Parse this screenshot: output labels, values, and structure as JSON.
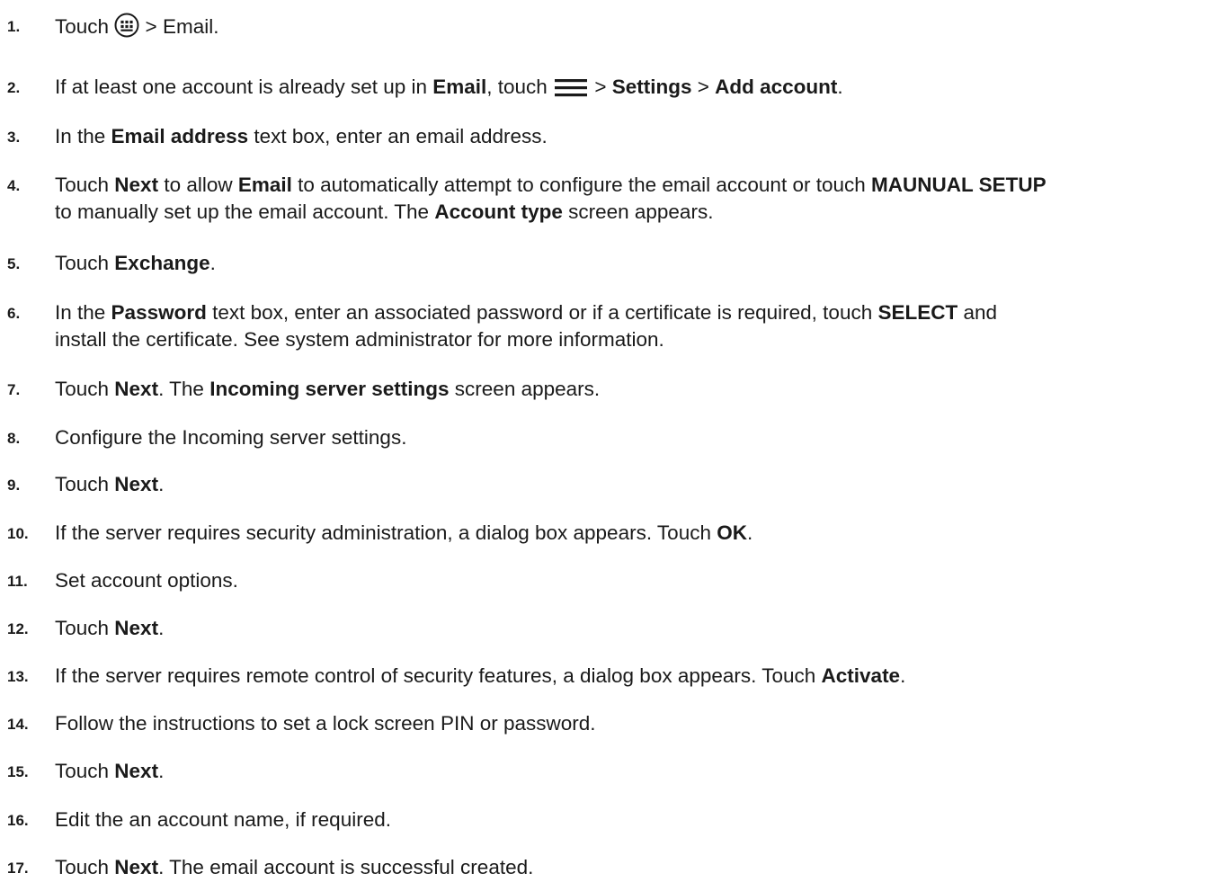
{
  "steps": [
    {
      "num": "1.",
      "parts": [
        {
          "t": "Touch "
        },
        {
          "icon": "apps-grid-icon"
        },
        {
          "t": " > Email."
        }
      ]
    },
    {
      "num": "2.",
      "parts": [
        {
          "t": "If at least one account is already set up in "
        },
        {
          "b": "Email"
        },
        {
          "t": ", touch "
        },
        {
          "icon": "menu-icon"
        },
        {
          "t": " > "
        },
        {
          "b": "Settings"
        },
        {
          "t": " > "
        },
        {
          "b": "Add account"
        },
        {
          "t": "."
        }
      ]
    },
    {
      "num": "3.",
      "parts": [
        {
          "t": "In the "
        },
        {
          "b": "Email address"
        },
        {
          "t": " text box, enter an email address."
        }
      ]
    },
    {
      "num": "4.",
      "parts": [
        {
          "t": "Touch "
        },
        {
          "b": "Next"
        },
        {
          "t": " to allow "
        },
        {
          "b": "Email"
        },
        {
          "t": " to automatically attempt to configure the email account or touch "
        },
        {
          "b": "MAUNUAL SETUP"
        },
        {
          "br": true
        },
        {
          "t": "to manually set up the email account. The "
        },
        {
          "b": "Account type"
        },
        {
          "t": " screen appears."
        }
      ]
    },
    {
      "num": "5.",
      "parts": [
        {
          "t": "Touch "
        },
        {
          "b": "Exchange"
        },
        {
          "t": "."
        }
      ]
    },
    {
      "num": "6.",
      "parts": [
        {
          "t": "In the "
        },
        {
          "b": "Password"
        },
        {
          "t": " text box, enter an associated password or if a certificate is required, touch "
        },
        {
          "b": "SELECT"
        },
        {
          "t": " and"
        },
        {
          "br": true
        },
        {
          "t": "install the certificate. See system administrator for more information."
        }
      ]
    },
    {
      "num": "7.",
      "parts": [
        {
          "t": "Touch "
        },
        {
          "b": "Next"
        },
        {
          "t": ". The "
        },
        {
          "b": "Incoming server settings"
        },
        {
          "t": " screen appears."
        }
      ]
    },
    {
      "num": "8.",
      "parts": [
        {
          "t": "Configure the Incoming server settings."
        }
      ]
    },
    {
      "num": "9.",
      "parts": [
        {
          "t": "Touch "
        },
        {
          "b": "Next"
        },
        {
          "t": "."
        }
      ]
    },
    {
      "num": "10.",
      "parts": [
        {
          "t": "If the server requires security administration, a dialog box appears. Touch "
        },
        {
          "b": "OK"
        },
        {
          "t": "."
        }
      ]
    },
    {
      "num": "11.",
      "parts": [
        {
          "t": "Set account options."
        }
      ]
    },
    {
      "num": "12.",
      "parts": [
        {
          "t": "Touch "
        },
        {
          "b": "Next"
        },
        {
          "t": "."
        }
      ]
    },
    {
      "num": "13.",
      "parts": [
        {
          "t": "If the server requires remote control of security features, a dialog box appears. Touch "
        },
        {
          "b": "Activate"
        },
        {
          "t": "."
        }
      ]
    },
    {
      "num": "14.",
      "parts": [
        {
          "t": "Follow the instructions to set a lock screen PIN or password."
        }
      ]
    },
    {
      "num": "15.",
      "parts": [
        {
          "t": "Touch "
        },
        {
          "b": "Next"
        },
        {
          "t": "."
        }
      ]
    },
    {
      "num": "16.",
      "parts": [
        {
          "t": "Edit the an account name, if required."
        }
      ]
    },
    {
      "num": "17.",
      "parts": [
        {
          "t": "Touch "
        },
        {
          "b": "Next"
        },
        {
          "t": ". The email account is successful created."
        }
      ]
    }
  ]
}
